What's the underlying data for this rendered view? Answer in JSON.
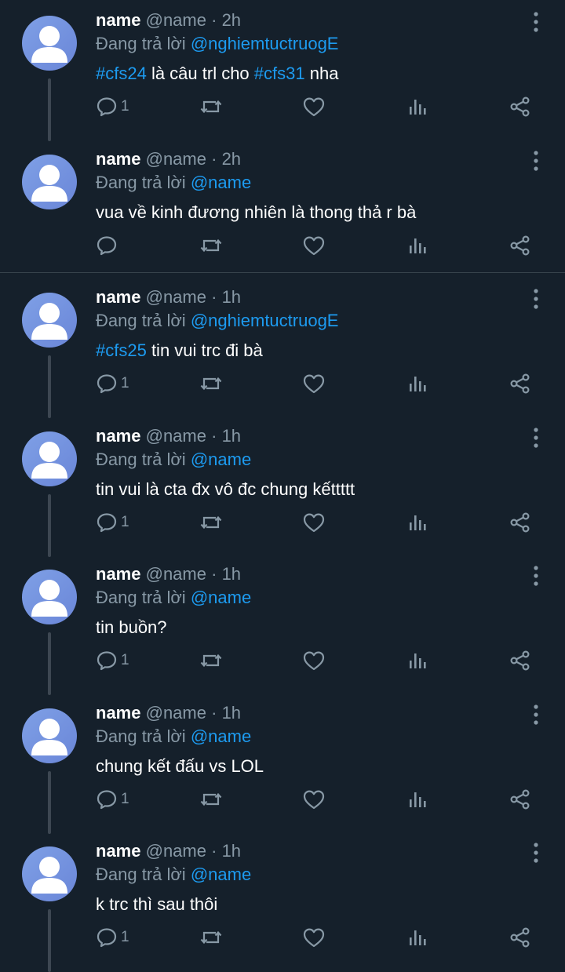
{
  "icons": {
    "avatar": "default-avatar-icon",
    "more": "more-vertical-icon",
    "reply": "reply-icon",
    "retweet": "retweet-icon",
    "like": "heart-icon",
    "views": "views-icon",
    "share": "share-icon"
  },
  "colors": {
    "background": "#15202b",
    "link": "#1d9bf0",
    "muted": "#8899a6",
    "avatar": "#7b9be0"
  },
  "tweets": [
    {
      "name": "name",
      "handle": "@name",
      "separator": "·",
      "time": "2h",
      "reply_prefix": "Đang trả lời",
      "reply_to": "@nghiemtuctruogE",
      "hashtag": "#cfs24",
      "text1": " là câu trl cho ",
      "hashtag2": "#cfs31",
      "text2": " nha",
      "reply_count": "1",
      "thread_line": true
    },
    {
      "name": "name",
      "handle": "@name",
      "separator": "·",
      "time": "2h",
      "reply_prefix": "Đang trả lời",
      "reply_to": "@name",
      "hashtag": "",
      "text1": "vua về kinh đương nhiên là thong thả r bà",
      "hashtag2": "",
      "text2": "",
      "reply_count": "",
      "thread_line": false
    },
    {
      "name": "name",
      "handle": "@name",
      "separator": "·",
      "time": "1h",
      "reply_prefix": "Đang trả lời",
      "reply_to": "@nghiemtuctruogE",
      "hashtag": "#cfs25",
      "text1": " tin vui trc đi bà",
      "hashtag2": "",
      "text2": "",
      "reply_count": "1",
      "thread_line": true
    },
    {
      "name": "name",
      "handle": "@name",
      "separator": "·",
      "time": "1h",
      "reply_prefix": "Đang trả lời",
      "reply_to": "@name",
      "hashtag": "",
      "text1": "tin vui là cta đx vô đc chung kếttttt",
      "hashtag2": "",
      "text2": "",
      "reply_count": "1",
      "thread_line": true
    },
    {
      "name": "name",
      "handle": "@name",
      "separator": "·",
      "time": "1h",
      "reply_prefix": "Đang trả lời",
      "reply_to": "@name",
      "hashtag": "",
      "text1": "tin buồn?",
      "hashtag2": "",
      "text2": "",
      "reply_count": "1",
      "thread_line": true
    },
    {
      "name": "name",
      "handle": "@name",
      "separator": "·",
      "time": "1h",
      "reply_prefix": "Đang trả lời",
      "reply_to": "@name",
      "hashtag": "",
      "text1": "chung kết đấu vs LOL",
      "hashtag2": "",
      "text2": "",
      "reply_count": "1",
      "thread_line": true
    },
    {
      "name": "name",
      "handle": "@name",
      "separator": "·",
      "time": "1h",
      "reply_prefix": "Đang trả lời",
      "reply_to": "@name",
      "hashtag": "",
      "text1": "k trc thì sau thôi",
      "hashtag2": "",
      "text2": "",
      "reply_count": "1",
      "thread_line": true
    }
  ]
}
